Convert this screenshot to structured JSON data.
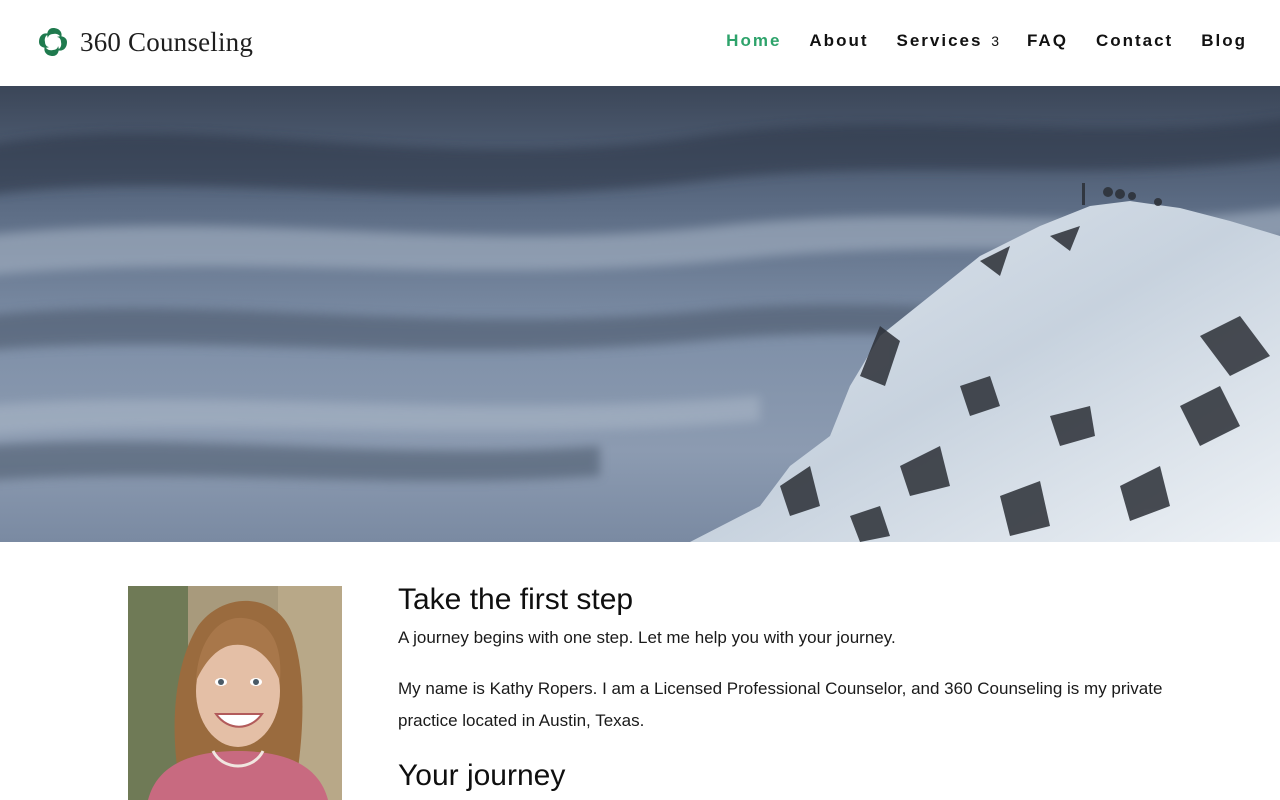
{
  "header": {
    "brand": "360 Counseling",
    "logo_icon": "swirl-logo-icon",
    "accent_color": "#2ea36b",
    "nav": [
      {
        "label": "Home",
        "active": true
      },
      {
        "label": "About"
      },
      {
        "label": "Services",
        "caret": "3"
      },
      {
        "label": "FAQ"
      },
      {
        "label": "Contact"
      },
      {
        "label": "Blog"
      }
    ]
  },
  "hero": {
    "image": "snowy-mountain-peak-under-cloudy-sky"
  },
  "main": {
    "heading": "Take the first step",
    "tagline": "A journey begins with one step. Let me help you with your journey.",
    "intro": "My name is Kathy Ropers. I am a Licensed Professional Counselor, and 360 Counseling is my private practice located in Austin, Texas.",
    "subheading": "Your journey"
  }
}
